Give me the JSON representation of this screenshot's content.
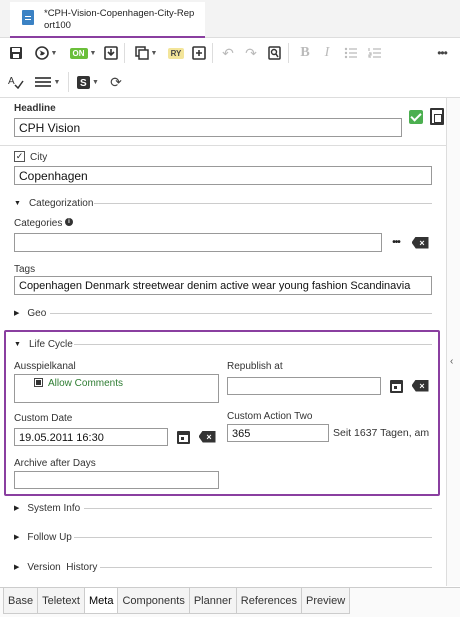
{
  "document_tab": {
    "title": "*CPH-Vision-Copenhagen-City-Report100"
  },
  "toolbar": {
    "on_badge": "ON",
    "ry_badge": "RY"
  },
  "fields": {
    "headline": {
      "label": "Headline",
      "value": "CPH Vision"
    },
    "city": {
      "label": "City",
      "value": "Copenhagen"
    },
    "categorization": {
      "label": "Categorization"
    },
    "categories": {
      "label": "Categories",
      "value": "",
      "more": "•••"
    },
    "tags": {
      "label": "Tags",
      "value": "Copenhagen  Denmark  streetwear  denim  active wear  young fashion  Scandinavia"
    },
    "geo": {
      "label": "Geo"
    }
  },
  "lifecycle": {
    "label": "Life Cycle",
    "ausspielkanal": {
      "label": "Ausspielkanal",
      "option": "Allow Comments"
    },
    "republish_at": {
      "label": "Republish at",
      "value": ""
    },
    "custom_date": {
      "label": "Custom Date",
      "value": "19.05.2011 16:30"
    },
    "custom_action_two": {
      "label": "Custom Action Two",
      "value": "365",
      "note": "Seit 1637 Tagen, am"
    },
    "archive_after_days": {
      "label": "Archive after Days",
      "value": ""
    }
  },
  "sections": {
    "system_info": "System Info",
    "follow_up": "Follow Up",
    "version_history": "Version  History"
  },
  "bottom_tabs": [
    {
      "label": "Base",
      "active": false
    },
    {
      "label": "Teletext",
      "active": false
    },
    {
      "label": "Meta",
      "active": true
    },
    {
      "label": "Components",
      "active": false
    },
    {
      "label": "Planner",
      "active": false
    },
    {
      "label": "References",
      "active": false
    },
    {
      "label": "Preview",
      "active": false
    }
  ],
  "colors": {
    "accent": "#8a3fa0",
    "success": "#4caf50",
    "option_text": "#2e7d32"
  }
}
